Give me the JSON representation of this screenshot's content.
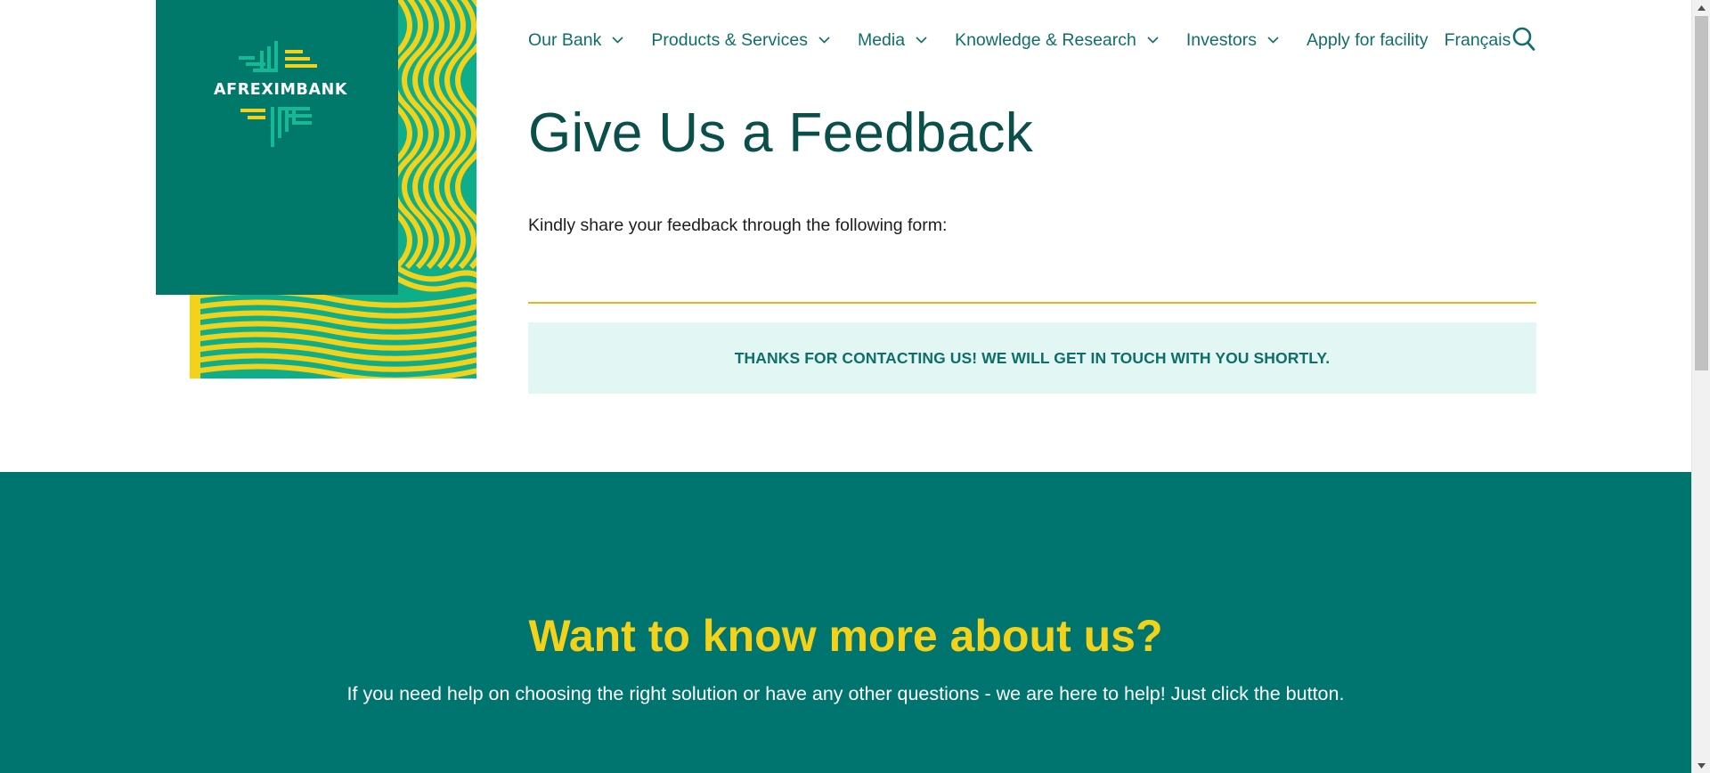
{
  "logo": {
    "text": "AFREXIMBANK",
    "icon": "afreximbank-logo-icon"
  },
  "nav": {
    "items": [
      {
        "label": "Our Bank",
        "has_dropdown": true
      },
      {
        "label": "Products & Services",
        "has_dropdown": true
      },
      {
        "label": "Media",
        "has_dropdown": true
      },
      {
        "label": "Knowledge & Research",
        "has_dropdown": true
      },
      {
        "label": "Investors",
        "has_dropdown": true
      },
      {
        "label": "Apply for facility",
        "has_dropdown": false
      },
      {
        "label": "Français",
        "has_dropdown": false
      }
    ],
    "search_icon": "search-icon"
  },
  "main": {
    "title": "Give Us a Feedback",
    "intro": "Kindly share your feedback through the following form:",
    "alert": "THANKS FOR CONTACTING US! WE WILL GET IN TOUCH WITH YOU SHORTLY."
  },
  "cta": {
    "title": "Want to know more about us?",
    "text": "If you need help on choosing the right solution or have any other questions - we are here to help! Just click the button."
  },
  "colors": {
    "brand_green": "#00786a",
    "brand_yellow": "#f5d21a",
    "text_teal": "#0f6f68",
    "alert_bg": "#e2f6f3",
    "rule_orange": "#f2b21a"
  }
}
